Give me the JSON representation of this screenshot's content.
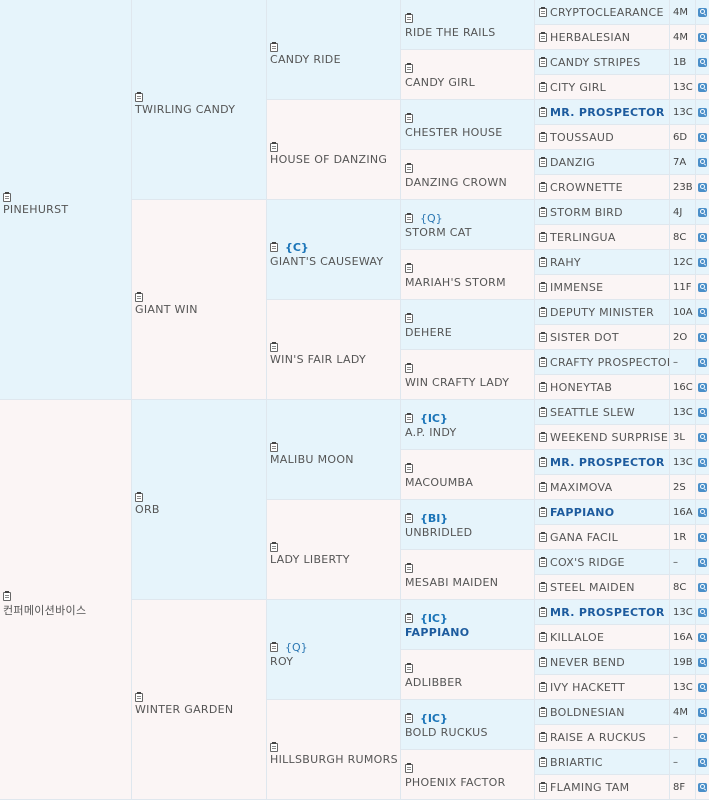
{
  "pedigree": {
    "g1": [
      {
        "name": "PINEHURST",
        "sex": "m"
      },
      {
        "name": "컨퍼메이션바이스",
        "sex": "f"
      }
    ],
    "g2": [
      {
        "name": "TWIRLING CANDY",
        "sex": "m"
      },
      {
        "name": "GIANT WIN",
        "sex": "f"
      },
      {
        "name": "ORB",
        "sex": "m"
      },
      {
        "name": "WINTER GARDEN",
        "sex": "f"
      }
    ],
    "g3": [
      {
        "name": "CANDY RIDE",
        "tag": "",
        "sex": "m"
      },
      {
        "name": "HOUSE OF DANZING",
        "tag": "",
        "sex": "f"
      },
      {
        "name": "GIANT'S CAUSEWAY",
        "tag": "{C}",
        "sex": "m"
      },
      {
        "name": "WIN'S FAIR LADY",
        "tag": "",
        "sex": "f"
      },
      {
        "name": "MALIBU MOON",
        "tag": "",
        "sex": "m"
      },
      {
        "name": "LADY LIBERTY",
        "tag": "",
        "sex": "f"
      },
      {
        "name": "ROY",
        "tag": "{Q}",
        "sex": "m"
      },
      {
        "name": "HILLSBURGH RUMORS",
        "tag": "",
        "sex": "f"
      }
    ],
    "g4": [
      {
        "name": "RIDE THE RAILS",
        "tag": "",
        "sex": "m"
      },
      {
        "name": "CANDY GIRL",
        "tag": "",
        "sex": "f"
      },
      {
        "name": "CHESTER HOUSE",
        "tag": "",
        "sex": "m"
      },
      {
        "name": "DANZING CROWN",
        "tag": "",
        "sex": "f"
      },
      {
        "name": "STORM CAT",
        "tag": "{Q}",
        "sex": "m"
      },
      {
        "name": "MARIAH'S STORM",
        "tag": "",
        "sex": "f"
      },
      {
        "name": "DEHERE",
        "tag": "",
        "sex": "m"
      },
      {
        "name": "WIN CRAFTY LADY",
        "tag": "",
        "sex": "f"
      },
      {
        "name": "A.P. INDY",
        "tag": "{IC}",
        "sex": "m"
      },
      {
        "name": "MACOUMBA",
        "tag": "",
        "sex": "f"
      },
      {
        "name": "UNBRIDLED",
        "tag": "{BI}",
        "sex": "m"
      },
      {
        "name": "MESABI MAIDEN",
        "tag": "",
        "sex": "f"
      },
      {
        "name": "FAPPIANO",
        "tag": "{IC}",
        "sex": "m",
        "highlight": true
      },
      {
        "name": "ADLIBBER",
        "tag": "",
        "sex": "f"
      },
      {
        "name": "BOLD RUCKUS",
        "tag": "{IC}",
        "sex": "m"
      },
      {
        "name": "PHOENIX FACTOR",
        "tag": "",
        "sex": "f"
      }
    ],
    "g5": [
      {
        "name": "CRYPTOCLEARANCE",
        "code": "4M",
        "sex": "m"
      },
      {
        "name": "HERBALESIAN",
        "code": "4M",
        "sex": "f"
      },
      {
        "name": "CANDY STRIPES",
        "code": "1B",
        "sex": "m"
      },
      {
        "name": "CITY GIRL",
        "code": "13C",
        "sex": "f"
      },
      {
        "name": "MR. PROSPECTOR",
        "code": "13C",
        "sex": "m",
        "highlight": true
      },
      {
        "name": "TOUSSAUD",
        "code": "6D",
        "sex": "f"
      },
      {
        "name": "DANZIG",
        "code": "7A",
        "sex": "m"
      },
      {
        "name": "CROWNETTE",
        "code": "23B",
        "sex": "f"
      },
      {
        "name": "STORM BIRD",
        "code": "4J",
        "sex": "m"
      },
      {
        "name": "TERLINGUA",
        "code": "8C",
        "sex": "f"
      },
      {
        "name": "RAHY",
        "code": "12C",
        "sex": "m"
      },
      {
        "name": "IMMENSE",
        "code": "11F",
        "sex": "f"
      },
      {
        "name": "DEPUTY MINISTER",
        "code": "10A",
        "sex": "m"
      },
      {
        "name": "SISTER DOT",
        "code": "2O",
        "sex": "f"
      },
      {
        "name": "CRAFTY PROSPECTOR",
        "code": "–",
        "sex": "m"
      },
      {
        "name": "HONEYTAB",
        "code": "16C",
        "sex": "f"
      },
      {
        "name": "SEATTLE SLEW",
        "code": "13C",
        "sex": "m"
      },
      {
        "name": "WEEKEND SURPRISE",
        "code": "3L",
        "sex": "f"
      },
      {
        "name": "MR. PROSPECTOR",
        "code": "13C",
        "sex": "m",
        "highlight": true
      },
      {
        "name": "MAXIMOVA",
        "code": "2S",
        "sex": "f"
      },
      {
        "name": "FAPPIANO",
        "code": "16A",
        "sex": "m",
        "highlight": true
      },
      {
        "name": "GANA FACIL",
        "code": "1R",
        "sex": "f"
      },
      {
        "name": "COX'S RIDGE",
        "code": "–",
        "sex": "m"
      },
      {
        "name": "STEEL MAIDEN",
        "code": "8C",
        "sex": "f"
      },
      {
        "name": "MR. PROSPECTOR",
        "code": "13C",
        "sex": "m",
        "highlight": true
      },
      {
        "name": "KILLALOE",
        "code": "16A",
        "sex": "f"
      },
      {
        "name": "NEVER BEND",
        "code": "19B",
        "sex": "m"
      },
      {
        "name": "IVY HACKETT",
        "code": "13C",
        "sex": "f"
      },
      {
        "name": "BOLDNESIAN",
        "code": "4M",
        "sex": "m"
      },
      {
        "name": "RAISE A RUCKUS",
        "code": "–",
        "sex": "f"
      },
      {
        "name": "BRIARTIC",
        "code": "–",
        "sex": "m"
      },
      {
        "name": "FLAMING TAM",
        "code": "8F",
        "sex": "f"
      }
    ]
  }
}
